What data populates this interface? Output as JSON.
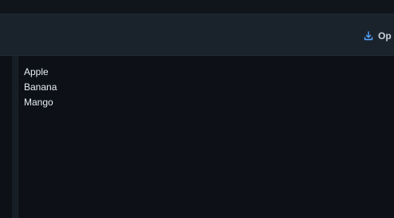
{
  "toolbar": {
    "open_label": "Op",
    "open_icon": "download-icon",
    "accent_color": "#58a6ff"
  },
  "content": {
    "lines": [
      "Apple",
      "Banana",
      "Mango"
    ]
  }
}
